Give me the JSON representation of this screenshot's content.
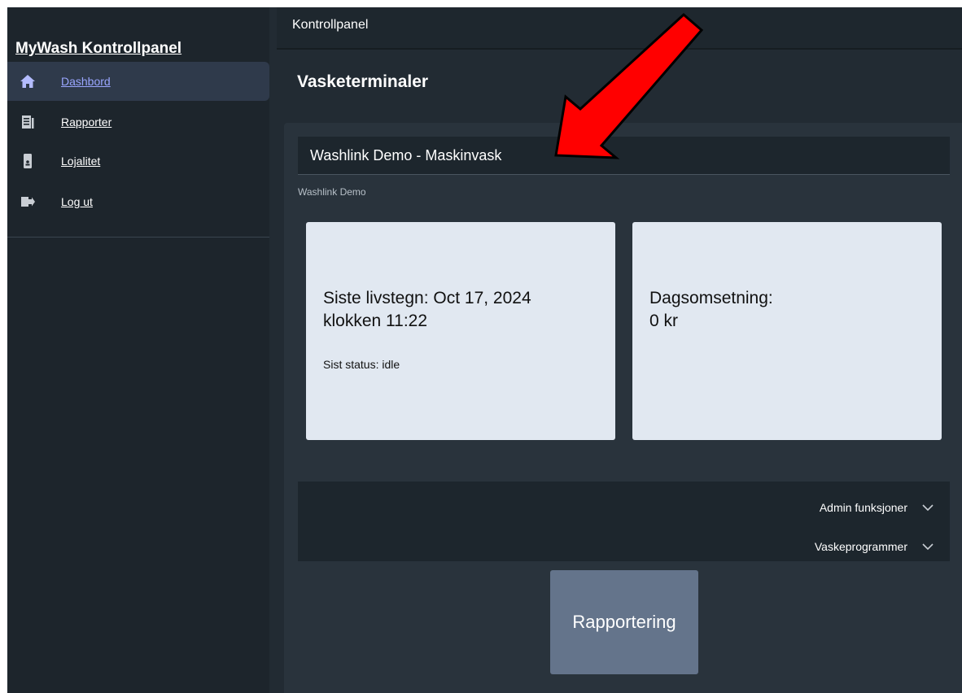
{
  "sidebar": {
    "app_title": "MyWash Kontrollpanel",
    "items": [
      {
        "label": "Dashbord",
        "icon": "home-icon",
        "active": true
      },
      {
        "label": "Rapporter",
        "icon": "report-icon"
      },
      {
        "label": "Lojalitet",
        "icon": "loyalty-card-icon"
      },
      {
        "label": "Log ut",
        "icon": "logout-icon"
      }
    ]
  },
  "header": {
    "title": "Kontrollpanel"
  },
  "main": {
    "section_title": "Vasketerminaler",
    "terminal": {
      "name": "Washlink Demo - Maskinvask",
      "subtitle": "Washlink Demo"
    },
    "cards": {
      "livstegn": {
        "line1": "Siste livstegn: Oct 17, 2024",
        "line2": "klokken 11:22",
        "status": "Sist status: idle"
      },
      "omsetning": {
        "line1": "Dagsomsetning:",
        "line2": "0 kr"
      }
    },
    "accordion": {
      "admin_label": "Admin funksjoner",
      "programs_label": "Vaskeprogrammer"
    },
    "report_button_label": "Rapportering"
  },
  "colors": {
    "background": "#222b33",
    "sidebar": "#1d252c",
    "active_nav": "#2f3a4b",
    "active_link": "#9aa6ff",
    "card": "#e1e8f1",
    "button": "#64748b",
    "annotation_arrow": "#ff0000"
  }
}
